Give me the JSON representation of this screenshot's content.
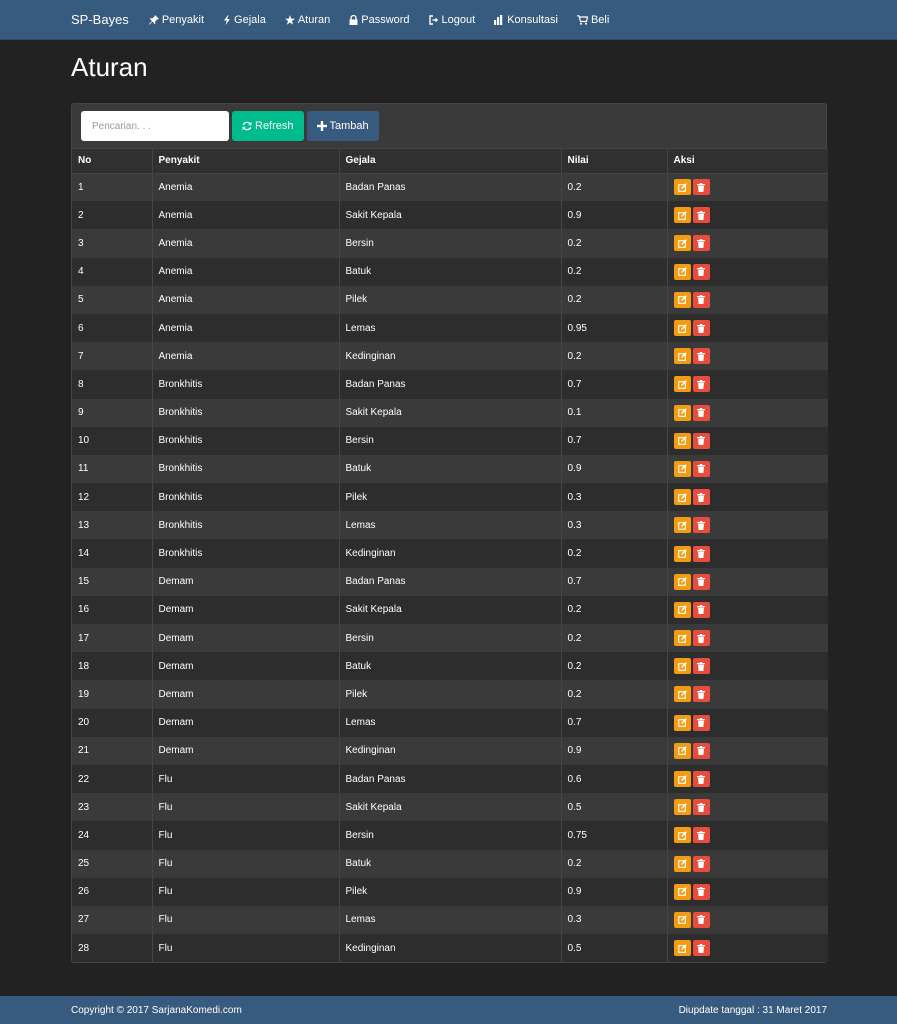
{
  "navbar": {
    "brand": "SP-Bayes",
    "items": [
      {
        "label": "Penyakit",
        "icon": "pushpin-icon"
      },
      {
        "label": "Gejala",
        "icon": "flash-icon"
      },
      {
        "label": "Aturan",
        "icon": "star-icon"
      },
      {
        "label": "Password",
        "icon": "lock-icon"
      },
      {
        "label": "Logout",
        "icon": "logout-icon"
      },
      {
        "label": "Konsultasi",
        "icon": "stats-icon"
      },
      {
        "label": "Beli",
        "icon": "cart-icon"
      }
    ]
  },
  "page": {
    "title": "Aturan"
  },
  "toolbar": {
    "search_placeholder": "Pencarian. . .",
    "refresh_label": "Refresh",
    "add_label": "Tambah"
  },
  "table": {
    "headers": [
      "No",
      "Penyakit",
      "Gejala",
      "Nilai",
      "Aksi"
    ],
    "rows": [
      [
        "1",
        "Anemia",
        "Badan Panas",
        "0.2"
      ],
      [
        "2",
        "Anemia",
        "Sakit Kepala",
        "0.9"
      ],
      [
        "3",
        "Anemia",
        "Bersin",
        "0.2"
      ],
      [
        "4",
        "Anemia",
        "Batuk",
        "0.2"
      ],
      [
        "5",
        "Anemia",
        "Pilek",
        "0.2"
      ],
      [
        "6",
        "Anemia",
        "Lemas",
        "0.95"
      ],
      [
        "7",
        "Anemia",
        "Kedinginan",
        "0.2"
      ],
      [
        "8",
        "Bronkhitis",
        "Badan Panas",
        "0.7"
      ],
      [
        "9",
        "Bronkhitis",
        "Sakit Kepala",
        "0.1"
      ],
      [
        "10",
        "Bronkhitis",
        "Bersin",
        "0.7"
      ],
      [
        "11",
        "Bronkhitis",
        "Batuk",
        "0.9"
      ],
      [
        "12",
        "Bronkhitis",
        "Pilek",
        "0.3"
      ],
      [
        "13",
        "Bronkhitis",
        "Lemas",
        "0.3"
      ],
      [
        "14",
        "Bronkhitis",
        "Kedinginan",
        "0.2"
      ],
      [
        "15",
        "Demam",
        "Badan Panas",
        "0.7"
      ],
      [
        "16",
        "Demam",
        "Sakit Kepala",
        "0.2"
      ],
      [
        "17",
        "Demam",
        "Bersin",
        "0.2"
      ],
      [
        "18",
        "Demam",
        "Batuk",
        "0.2"
      ],
      [
        "19",
        "Demam",
        "Pilek",
        "0.2"
      ],
      [
        "20",
        "Demam",
        "Lemas",
        "0.7"
      ],
      [
        "21",
        "Demam",
        "Kedinginan",
        "0.9"
      ],
      [
        "22",
        "Flu",
        "Badan Panas",
        "0.6"
      ],
      [
        "23",
        "Flu",
        "Sakit Kepala",
        "0.5"
      ],
      [
        "24",
        "Flu",
        "Bersin",
        "0.75"
      ],
      [
        "25",
        "Flu",
        "Batuk",
        "0.2"
      ],
      [
        "26",
        "Flu",
        "Pilek",
        "0.9"
      ],
      [
        "27",
        "Flu",
        "Lemas",
        "0.3"
      ],
      [
        "28",
        "Flu",
        "Kedinginan",
        "0.5"
      ]
    ]
  },
  "footer": {
    "copyright": "Copyright © 2017 SarjanaKomedi.com",
    "updated": "Diupdate tanggal : 31 Maret 2017"
  },
  "colors": {
    "navbar": "#375a7f",
    "background": "#222222",
    "refresh": "#00bc8c",
    "edit": "#f39c12",
    "delete": "#e74c3c"
  }
}
